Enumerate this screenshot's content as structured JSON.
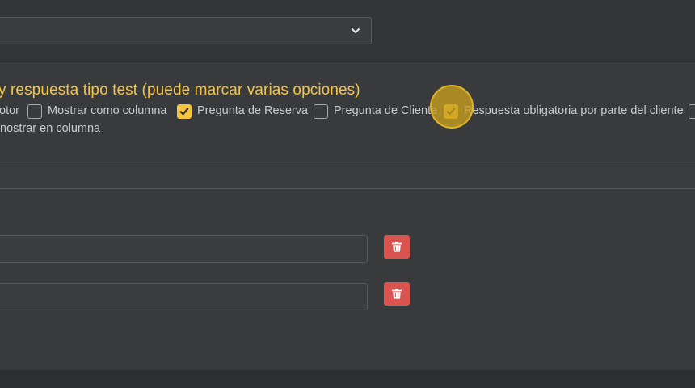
{
  "top_select": {
    "value": "",
    "icon": "chevron-down-icon"
  },
  "question": {
    "title": "y respuesta tipo test (puede marcar varias opciones)",
    "options": [
      {
        "label": "otor",
        "checked": null
      },
      {
        "label": "Mostrar como columna",
        "checked": false
      },
      {
        "label": "Pregunta de Reserva",
        "checked": true
      },
      {
        "label": "Pregunta de Cliente",
        "checked": false
      },
      {
        "label": "Respuesta obligatoria por parte del cliente",
        "checked": true
      },
      {
        "label": "",
        "checked": false
      }
    ],
    "row2_label": "nostrar en columna",
    "wide_field_value": ""
  },
  "answers": [
    {
      "value": "",
      "delete_icon": "trash-icon"
    },
    {
      "value": "",
      "delete_icon": "trash-icon"
    }
  ],
  "colors": {
    "accent": "#f6c440",
    "danger": "#d9534f",
    "panel": "#393a3c",
    "background": "#2d2e30"
  }
}
